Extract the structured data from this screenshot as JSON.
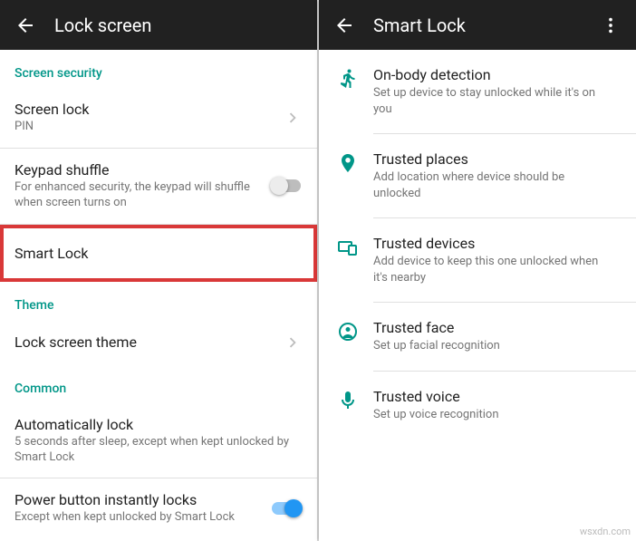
{
  "left": {
    "appbar_title": "Lock screen",
    "sections": {
      "security": "Screen security",
      "theme": "Theme",
      "common": "Common"
    },
    "rows": {
      "screenlock": {
        "title": "Screen lock",
        "subtitle": "PIN"
      },
      "keypad": {
        "title": "Keypad shuffle",
        "subtitle": "For enhanced security, the keypad will shuffle when screen turns on"
      },
      "smartlock": {
        "title": "Smart Lock"
      },
      "theme": {
        "title": "Lock screen theme"
      },
      "autolock": {
        "title": "Automatically lock",
        "subtitle": "5 seconds after sleep, except when kept unlocked by Smart Lock"
      },
      "powerbtn": {
        "title": "Power button instantly locks",
        "subtitle": "Except when kept unlocked by Smart Lock"
      }
    }
  },
  "right": {
    "appbar_title": "Smart Lock",
    "items": [
      {
        "icon": "walking",
        "title": "On-body detection",
        "subtitle": "Set up device to stay unlocked while it's on you"
      },
      {
        "icon": "place",
        "title": "Trusted places",
        "subtitle": "Add location where device should be unlocked"
      },
      {
        "icon": "devices",
        "title": "Trusted devices",
        "subtitle": "Add device to keep this one unlocked when it's nearby"
      },
      {
        "icon": "face",
        "title": "Trusted face",
        "subtitle": "Set up facial recognition"
      },
      {
        "icon": "mic",
        "title": "Trusted voice",
        "subtitle": "Set up voice recognition"
      }
    ]
  },
  "watermark": "wsxdn.com"
}
